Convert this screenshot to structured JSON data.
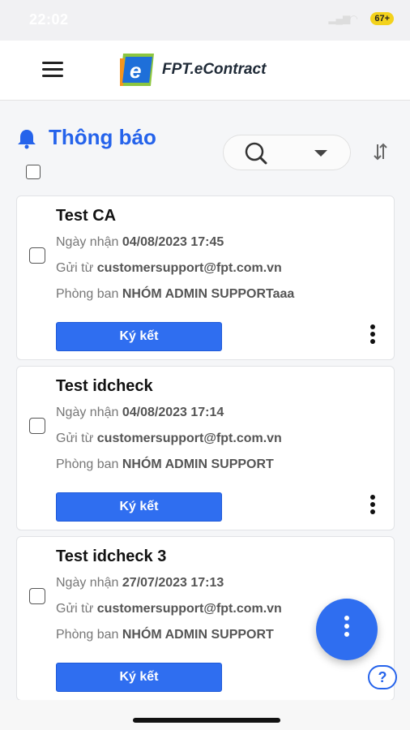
{
  "status_bar": {
    "time": "22:02",
    "battery": "67+"
  },
  "header": {
    "app_name": "FPT.eContract",
    "logo_letter": "e"
  },
  "section": {
    "title": "Thông báo"
  },
  "labels": {
    "received": "Ngày nhận",
    "sent_from": "Gửi từ",
    "department": "Phòng ban"
  },
  "cards": [
    {
      "title": "Test CA",
      "received": "04/08/2023 17:45",
      "sender": "customersupport@fpt.com.vn",
      "department": "NHÓM ADMIN SUPPORTaaa",
      "action": "Ký kết"
    },
    {
      "title": "Test idcheck",
      "received": "04/08/2023 17:14",
      "sender": "customersupport@fpt.com.vn",
      "department": "NHÓM ADMIN SUPPORT",
      "action": "Ký kết"
    },
    {
      "title": "Test idcheck 3",
      "received": "27/07/2023 17:13",
      "sender": "customersupport@fpt.com.vn",
      "department": "NHÓM ADMIN SUPPORT",
      "action": "Ký kết"
    }
  ],
  "help": {
    "label": "?"
  },
  "colors": {
    "accent": "#2f6ef0",
    "title_blue": "#2563eb",
    "logo_green": "#8cc63f",
    "logo_orange": "#f7941d"
  }
}
